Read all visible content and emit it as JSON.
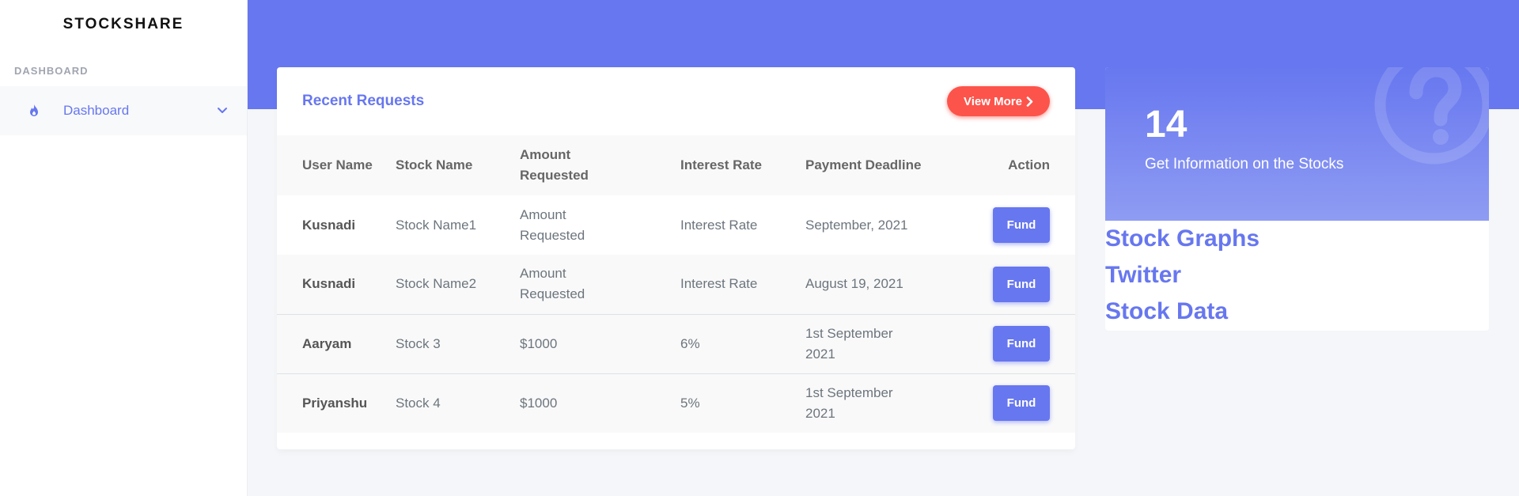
{
  "sidebar": {
    "brand": "STOCKSHARE",
    "section_header": "DASHBOARD",
    "items": [
      {
        "label": "Dashboard",
        "icon": "fire-icon"
      }
    ]
  },
  "requests": {
    "title": "Recent Requests",
    "view_more_label": "View More",
    "columns": [
      "User Name",
      "Stock Name",
      "Amount Requested",
      "Interest Rate",
      "Payment Deadline",
      "Action"
    ],
    "rows": [
      {
        "user": "Kusnadi",
        "stock": "Stock Name1",
        "amount": "Amount Requested",
        "rate": "Interest Rate",
        "deadline": "September, 2021",
        "action": "Fund"
      },
      {
        "user": "Kusnadi",
        "stock": "Stock Name2",
        "amount": "Amount Requested",
        "rate": "Interest Rate",
        "deadline": "August 19, 2021",
        "action": "Fund"
      },
      {
        "user": "Aaryam",
        "stock": "Stock 3",
        "amount": "$1000",
        "rate": "6%",
        "deadline": "1st September 2021",
        "action": "Fund"
      },
      {
        "user": "Priyanshu",
        "stock": "Stock 4",
        "amount": "$1000",
        "rate": "5%",
        "deadline": "1st September 2021",
        "action": "Fund"
      }
    ]
  },
  "info_card": {
    "number": "14",
    "caption": "Get Information on the Stocks",
    "icon": "question-circle-icon",
    "links": [
      "Stock Graphs",
      "Twitter",
      "Stock Data"
    ]
  },
  "colors": {
    "primary": "#6777ef",
    "danger": "#fc544b",
    "background": "#f4f6f9"
  }
}
